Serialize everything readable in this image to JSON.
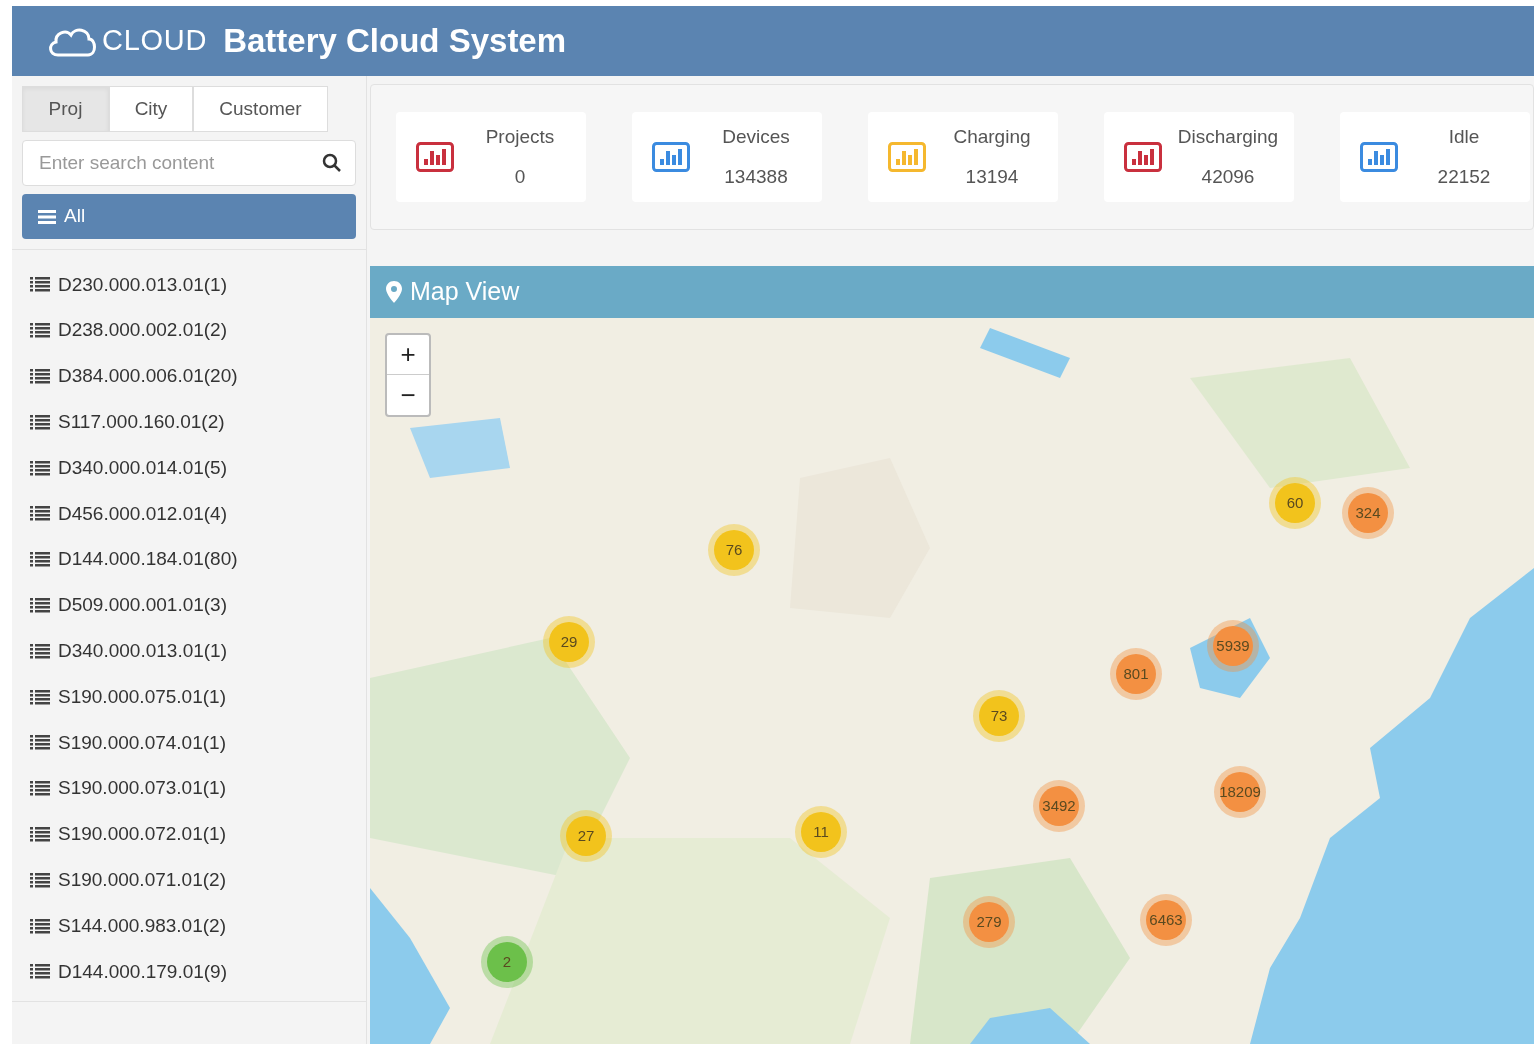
{
  "header": {
    "logo_text": "CLOUD",
    "title": "Battery Cloud System"
  },
  "sidebar": {
    "tabs": [
      {
        "label": "Proj",
        "selected": true
      },
      {
        "label": "City",
        "selected": false
      },
      {
        "label": "Customer",
        "selected": false
      }
    ],
    "search": {
      "placeholder": "Enter search content"
    },
    "all_button": "All",
    "items": [
      "D230.000.013.01(1)",
      "D238.000.002.01(2)",
      "D384.000.006.01(20)",
      "S117.000.160.01(2)",
      "D340.000.014.01(5)",
      "D456.000.012.01(4)",
      "D144.000.184.01(80)",
      "D509.000.001.01(3)",
      "D340.000.013.01(1)",
      "S190.000.075.01(1)",
      "S190.000.074.01(1)",
      "S190.000.073.01(1)",
      "S190.000.072.01(1)",
      "S190.000.071.01(2)",
      "S144.000.983.01(2)",
      "D144.000.179.01(9)"
    ]
  },
  "stats": [
    {
      "label": "Projects",
      "value": "0",
      "color": "#c9303e"
    },
    {
      "label": "Devices",
      "value": "134388",
      "color": "#3b8be0"
    },
    {
      "label": "Charging",
      "value": "13194",
      "color": "#f5b82e"
    },
    {
      "label": "Discharging",
      "value": "42096",
      "color": "#c9303e"
    },
    {
      "label": "Idle",
      "value": "22152",
      "color": "#3b8be0"
    }
  ],
  "map": {
    "title": "Map View",
    "zoom_in": "+",
    "zoom_out": "−",
    "clusters": [
      {
        "count": "60",
        "color": "#f2c31c"
      },
      {
        "count": "324",
        "color": "#f39042"
      },
      {
        "count": "76",
        "color": "#f2c31c"
      },
      {
        "count": "29",
        "color": "#f2c31c"
      },
      {
        "count": "5939",
        "color": "#f39042"
      },
      {
        "count": "801",
        "color": "#f39042"
      },
      {
        "count": "73",
        "color": "#f2c31c"
      },
      {
        "count": "3492",
        "color": "#f39042"
      },
      {
        "count": "18209",
        "color": "#f39042"
      },
      {
        "count": "27",
        "color": "#f2c31c"
      },
      {
        "count": "11",
        "color": "#f2c31c"
      },
      {
        "count": "279",
        "color": "#f39042"
      },
      {
        "count": "6463",
        "color": "#f39042"
      },
      {
        "count": "2",
        "color": "#6cc04a"
      }
    ]
  }
}
